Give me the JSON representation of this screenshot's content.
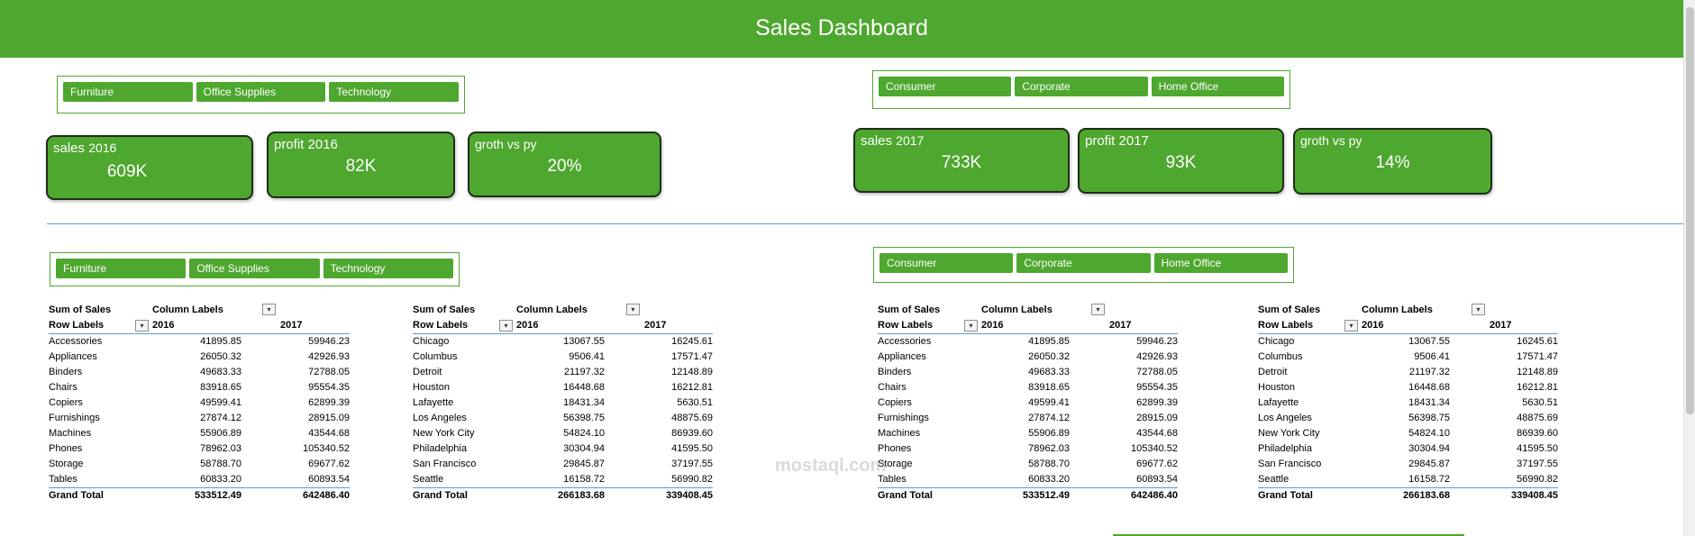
{
  "header": {
    "title": "Sales Dashboard"
  },
  "slicers": {
    "category_top": [
      "Furniture",
      "Office Supplies",
      "Technology"
    ],
    "segment_top": [
      "Consumer",
      "Corporate",
      "Home Office"
    ],
    "category_bottom": [
      "Furniture",
      "Office Supplies",
      "Technology"
    ],
    "segment_bottom": [
      "Consumer",
      "Corporate",
      "Home Office"
    ]
  },
  "kpi_2016": {
    "sales": {
      "label": "sales",
      "year": "2016",
      "value": "609K"
    },
    "profit": {
      "label": "profit  2016",
      "value": "82K"
    },
    "growth": {
      "label": "groth vs py",
      "value": "20%"
    }
  },
  "kpi_2017": {
    "sales": {
      "label": "sales",
      "year": "2017",
      "value": "733K"
    },
    "profit": {
      "label": "profit 2017",
      "value": "93K"
    },
    "growth": {
      "label": "groth vs py",
      "value": "14%"
    }
  },
  "pivot_labels": {
    "sum_of_sales": "Sum of Sales",
    "column_labels": "Column Labels",
    "row_labels": "Row Labels",
    "y2016": "2016",
    "y2017": "2017",
    "grand_total": "Grand Total"
  },
  "pivot_subcategory": {
    "rows": [
      [
        "Accessories",
        "41895.85",
        "59946.23"
      ],
      [
        "Appliances",
        "26050.32",
        "42926.93"
      ],
      [
        "Binders",
        "49683.33",
        "72788.05"
      ],
      [
        "Chairs",
        "83918.65",
        "95554.35"
      ],
      [
        "Copiers",
        "49599.41",
        "62899.39"
      ],
      [
        "Furnishings",
        "27874.12",
        "28915.09"
      ],
      [
        "Machines",
        "55906.89",
        "43544.68"
      ],
      [
        "Phones",
        "78962.03",
        "105340.52"
      ],
      [
        "Storage",
        "58788.70",
        "69677.62"
      ],
      [
        "Tables",
        "60833.20",
        "60893.54"
      ]
    ],
    "total": [
      "533512.49",
      "642486.40"
    ]
  },
  "pivot_city": {
    "rows": [
      [
        "Chicago",
        "13067.55",
        "16245.61"
      ],
      [
        "Columbus",
        "9506.41",
        "17571.47"
      ],
      [
        "Detroit",
        "21197.32",
        "12148.89"
      ],
      [
        "Houston",
        "16448.68",
        "16212.81"
      ],
      [
        "Lafayette",
        "18431.34",
        "5630.51"
      ],
      [
        "Los Angeles",
        "56398.75",
        "48875.69"
      ],
      [
        "New York City",
        "54824.10",
        "86939.60"
      ],
      [
        "Philadelphia",
        "30304.94",
        "41595.50"
      ],
      [
        "San Francisco",
        "29845.87",
        "37197.55"
      ],
      [
        "Seattle",
        "16158.72",
        "56990.82"
      ]
    ],
    "total": [
      "266183.68",
      "339408.45"
    ]
  },
  "watermark": "mostaql.com",
  "colors": {
    "accent": "#4ea72e",
    "card_border": "#1f2d19",
    "table_line": "#5b9bd5"
  }
}
